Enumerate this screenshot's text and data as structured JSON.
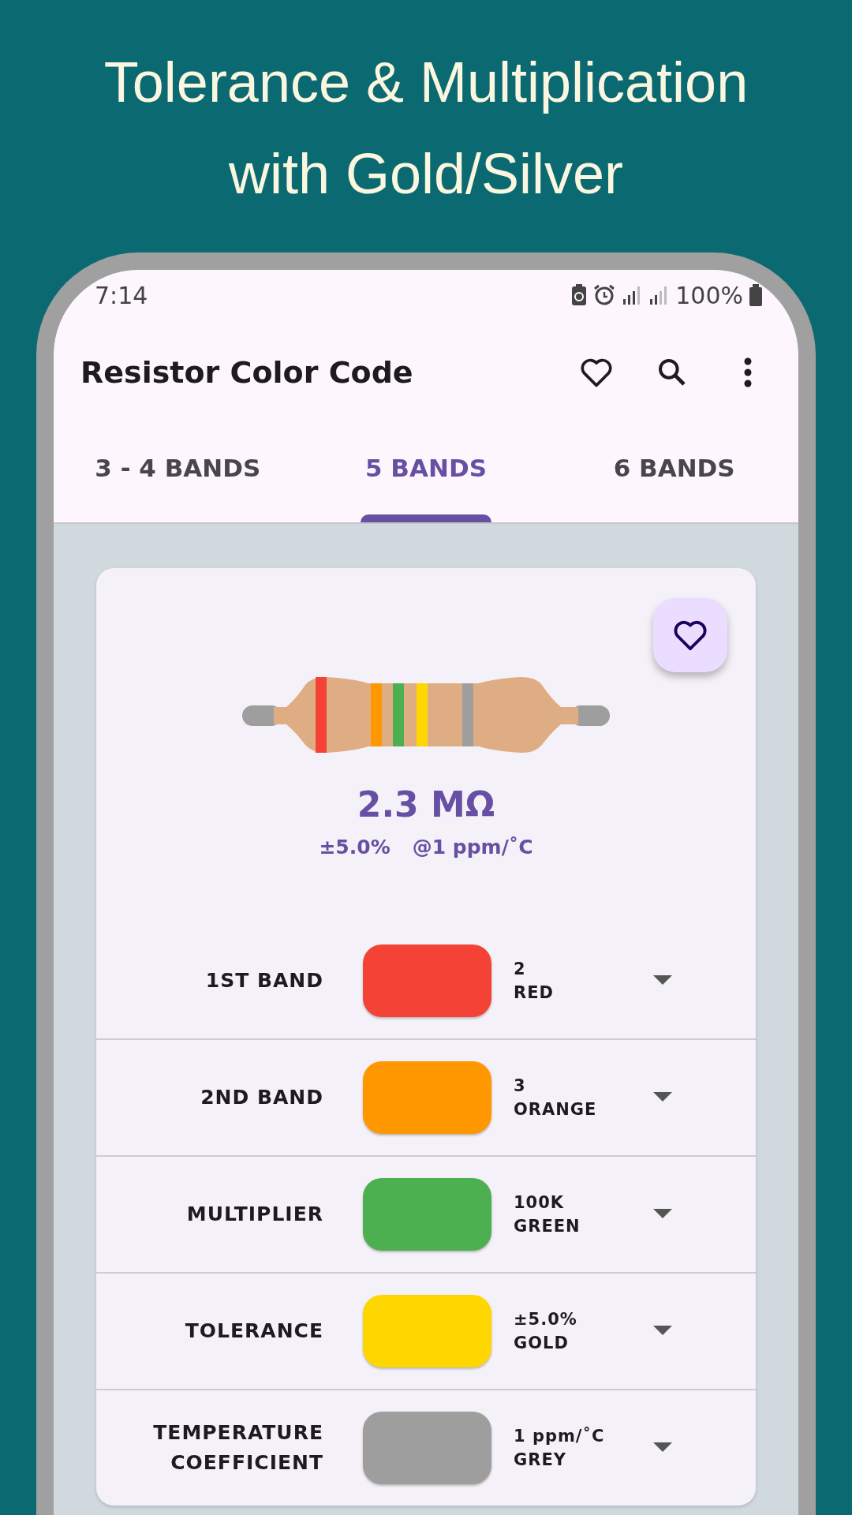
{
  "headline": [
    "Tolerance & Multiplication",
    "with Gold/Silver"
  ],
  "status_bar": {
    "time": "7:14",
    "battery": "100%"
  },
  "app_bar": {
    "title": "Resistor Color Code"
  },
  "tabs": [
    {
      "label": "3 - 4 BANDS",
      "selected": false
    },
    {
      "label": "5 BANDS",
      "selected": true
    },
    {
      "label": "6 BANDS",
      "selected": false
    }
  ],
  "result": {
    "value": "2.3 MΩ",
    "tolerance": "±5.0%",
    "temperature": "@1 ppm/˚C"
  },
  "bands": [
    {
      "label": "1ST BAND",
      "value": "2",
      "color_name": "RED",
      "color": "#f44336"
    },
    {
      "label": "2ND BAND",
      "value": "3",
      "color_name": "ORANGE",
      "color": "#ff9800"
    },
    {
      "label": "MULTIPLIER",
      "value": "100K",
      "color_name": "GREEN",
      "color": "#4caf50"
    },
    {
      "label": "TOLERANCE",
      "value": "±5.0%",
      "color_name": "GOLD",
      "color": "#ffd700"
    },
    {
      "label": "TEMPERATURE COEFFICIENT",
      "value": "1 ppm/˚C",
      "color_name": "GREY",
      "color": "#9e9e9e"
    }
  ]
}
